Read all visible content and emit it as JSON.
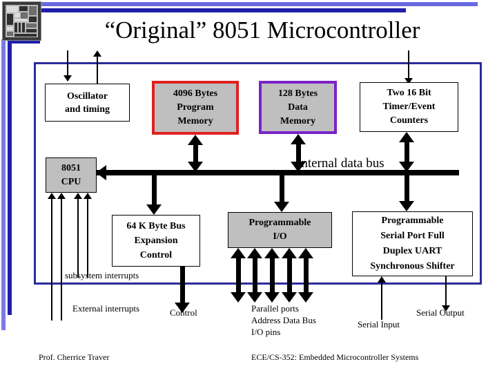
{
  "slide": {
    "title": "“Original” 8051 Microcontroller",
    "footer_author": "Prof. Cherrice Traver",
    "footer_course": "ECE/CS-352: Embedded Microcontroller Systems"
  },
  "colors": {
    "rail_light_blue": "#7b7be8",
    "rail_dark_blue": "#1f1fa8",
    "frame_blue": "#2a2a9c",
    "box_gray_fill": "#bfbfbf",
    "program_memory_border": "#e02020",
    "data_memory_border": "#7a22c8",
    "arrow_black": "#000000"
  },
  "blocks": {
    "oscillator": {
      "lines": [
        "Oscillator",
        "and timing"
      ]
    },
    "program_memory": {
      "lines": [
        "4096 Bytes",
        "Program",
        "Memory"
      ]
    },
    "data_memory": {
      "lines": [
        "128 Bytes",
        "Data",
        "Memory"
      ]
    },
    "timers": {
      "lines": [
        "Two 16 Bit",
        "Timer/Event",
        "Counters"
      ]
    },
    "cpu": {
      "lines": [
        "8051",
        "CPU"
      ]
    },
    "bus_expansion": {
      "lines": [
        "64 K Byte Bus",
        "Expansion",
        "Control"
      ]
    },
    "programmable_io": {
      "lines": [
        "Programmable",
        "I/O"
      ]
    },
    "serial_port": {
      "lines": [
        "Programmable",
        "Serial Port Full",
        "Duplex UART",
        "Synchronous Shifter"
      ]
    }
  },
  "bus": {
    "label": "Internal data bus"
  },
  "annotations": {
    "subsystem_interrupts": "subsystem interrupts",
    "external_interrupts": "External interrupts",
    "control": "Control",
    "parallel_ports": [
      "Parallel ports",
      "Address Data Bus",
      "I/O pins"
    ],
    "serial_input": "Serial Input",
    "serial_output": "Serial Output"
  },
  "chip_photo": {
    "alt": "8051 die micrograph"
  }
}
